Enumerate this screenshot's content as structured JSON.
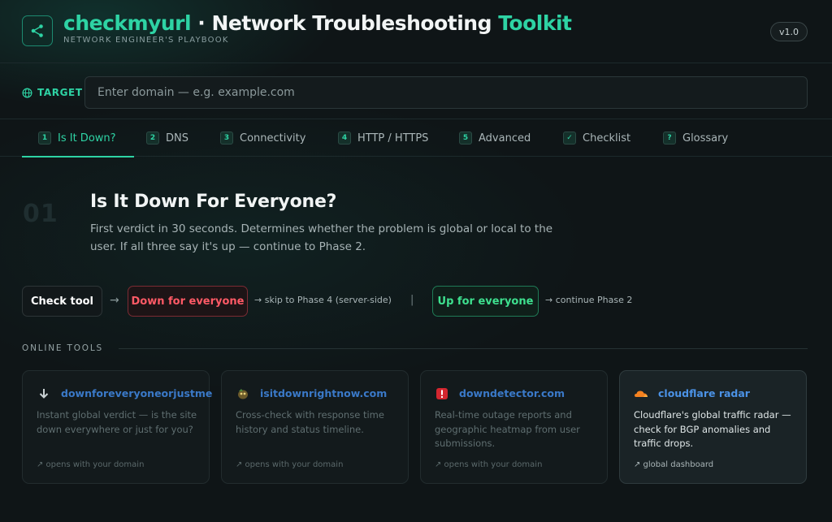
{
  "header": {
    "title_main": "checkmyurl",
    "title_sep": " · ",
    "title_rest": "Network Troubleshooting ",
    "title_accent": "Toolkit",
    "subtitle": "NETWORK ENGINEER'S PLAYBOOK",
    "version": "v1.0"
  },
  "target": {
    "label": "TARGET",
    "placeholder": "Enter domain — e.g. example.com",
    "value": ""
  },
  "tabs": [
    {
      "num": "1",
      "label": "Is It Down?",
      "active": true
    },
    {
      "num": "2",
      "label": "DNS"
    },
    {
      "num": "3",
      "label": "Connectivity"
    },
    {
      "num": "4",
      "label": "HTTP / HTTPS"
    },
    {
      "num": "5",
      "label": "Advanced"
    },
    {
      "num": "✓",
      "label": "Checklist"
    },
    {
      "num": "?",
      "label": "Glossary"
    }
  ],
  "section": {
    "number": "01",
    "title": "Is It Down For Everyone?",
    "description": "First verdict in 30 seconds. Determines whether the problem is global or local to the user. If all three say it's up — continue to Phase 2."
  },
  "flow": {
    "check_tool": "Check tool",
    "arrow": "→",
    "down_label": "Down for everyone",
    "down_note": "→ skip to Phase 4 (server-side)",
    "separator": "|",
    "up_label": "Up for everyone",
    "up_note": "→ continue Phase 2"
  },
  "tools": {
    "heading": "ONLINE TOOLS",
    "cards": [
      {
        "icon": "down-arrow-icon",
        "title": "downforeveryoneorjustme",
        "description": "Instant global verdict — is the site down everywhere or just for you?",
        "footer": "↗ opens with your domain"
      },
      {
        "icon": "sloth-icon",
        "title": "isitdownrightnow.com",
        "description": "Cross-check with response time history and status timeline.",
        "footer": "↗ opens with your domain"
      },
      {
        "icon": "alert-icon",
        "title": "downdetector.com",
        "description": "Real-time outage reports and geographic heatmap from user submissions.",
        "footer": "↗ opens with your domain"
      },
      {
        "icon": "cloud-icon",
        "title": "cloudflare radar",
        "description": "Cloudflare's global traffic radar — check for BGP anomalies and traffic drops.",
        "footer": "↗ global dashboard"
      }
    ]
  },
  "colors": {
    "accent": "#2ed3a4",
    "down": "#ff5a66",
    "up": "#3ee08f",
    "link": "#3a79c8"
  }
}
